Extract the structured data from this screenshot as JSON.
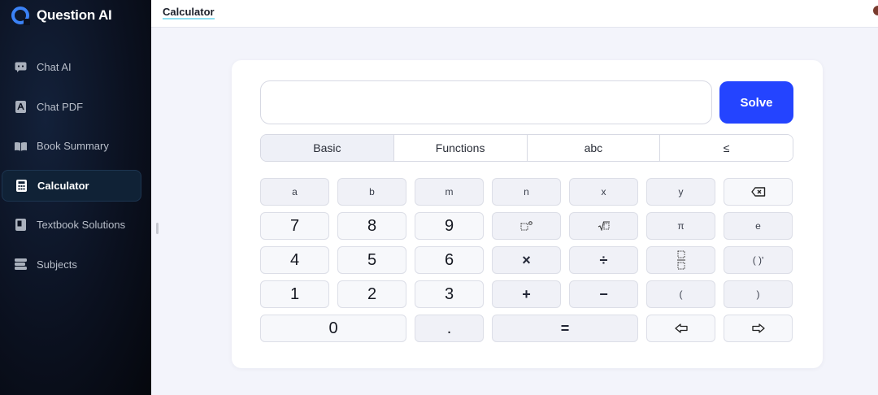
{
  "app": {
    "name": "Question AI"
  },
  "sidebar": {
    "items": [
      {
        "label": "Chat AI",
        "icon": "chat-icon",
        "active": false
      },
      {
        "label": "Chat PDF",
        "icon": "pdf-icon",
        "active": false
      },
      {
        "label": "Book Summary",
        "icon": "book-icon",
        "active": false
      },
      {
        "label": "Calculator",
        "icon": "calculator-icon",
        "active": true
      },
      {
        "label": "Textbook Solutions",
        "icon": "textbook-icon",
        "active": false
      },
      {
        "label": "Subjects",
        "icon": "subjects-icon",
        "active": false
      }
    ]
  },
  "header": {
    "title": "Calculator"
  },
  "calculator": {
    "input_value": "",
    "solve_label": "Solve",
    "tabs": [
      "Basic",
      "Functions",
      "abc",
      "≤"
    ],
    "active_tab": "Basic",
    "keys": {
      "row1": [
        "a",
        "b",
        "m",
        "n",
        "x",
        "y"
      ],
      "row2": [
        "7",
        "8",
        "9",
        "π",
        "e"
      ],
      "row3": [
        "4",
        "5",
        "6",
        "×",
        "÷",
        "( )ʹ"
      ],
      "row4": [
        "1",
        "2",
        "3",
        "+",
        "−",
        "(",
        ")"
      ],
      "row5": [
        "0",
        ".",
        "="
      ]
    },
    "icon_keys": [
      "backspace-icon",
      "degree-icon",
      "sqrt-icon",
      "fraction-icon",
      "arrow-left-icon",
      "arrow-right-icon"
    ]
  }
}
